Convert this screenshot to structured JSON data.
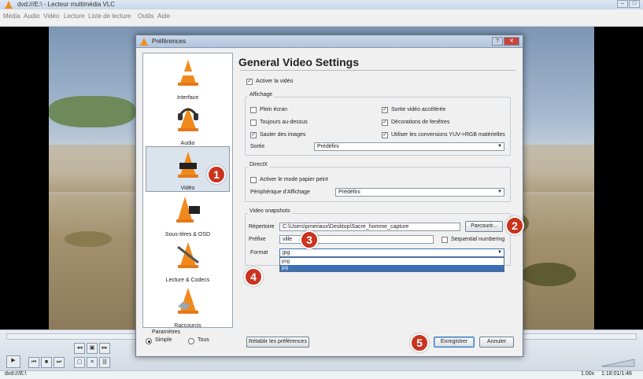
{
  "window": {
    "title": "dvd:///E:\\ - Lecteur multimédia VLC"
  },
  "menu": [
    "Média",
    "Audio",
    "Vidéo",
    "Lecture",
    "Liste de lecture",
    "Outils",
    "Aide"
  ],
  "status": {
    "path": "dvd:///E:\\",
    "speed": "1.00x",
    "time": "1:18:01/1:46"
  },
  "dialog": {
    "title": "Préférences",
    "panel_title": "General Video Settings",
    "categories": [
      {
        "label": "Interface",
        "icon": "interface-icon"
      },
      {
        "label": "Audio",
        "icon": "audio-icon"
      },
      {
        "label": "Vidéo",
        "icon": "video-icon"
      },
      {
        "label": "Sous-titres & OSD",
        "icon": "subtitles-icon"
      },
      {
        "label": "Lecture & Codecs",
        "icon": "codecs-icon"
      },
      {
        "label": "Raccourcis",
        "icon": "hotkeys-icon"
      }
    ],
    "params_label": "Paramètres",
    "mode_simple": "Simple",
    "mode_all": "Tous",
    "enable_video": "Activer la vidéo",
    "display_group": "Affichage",
    "fullscreen": "Plein écran",
    "always_on_top": "Toujours au-dessus",
    "skip_frames": "Sauter des images",
    "accel_output": "Sortie vidéo accélérée",
    "window_decorations": "Décorations de fenêtres",
    "yuv_rgb": "Utiliser les conversions YUV->RGB matérielles",
    "output_label": "Sortie",
    "output_value": "Prédéfini",
    "directx_group": "DirectX",
    "wallpaper_mode": "Activer le mode papier peint",
    "display_device_label": "Périphérique d'Affichage",
    "display_device_value": "Prédéfini",
    "snapshots_group": "Video snapshots",
    "directory_label": "Répertoire",
    "directory_value": "C:\\Users\\pmeriaux\\Desktop\\Sacre_homme_capture",
    "browse_button": "Parcourir...",
    "prefix_label": "Préfixe",
    "prefix_value": "ville",
    "sequential_numbering": "Sequential numbering",
    "format_label": "Format",
    "format_value": "jpg",
    "format_options": [
      "png",
      "jpg"
    ],
    "reset_button": "Rétablir les préférences",
    "save_button": "Enregistrer",
    "cancel_button": "Annuler"
  },
  "callouts": [
    "1",
    "2",
    "3",
    "4",
    "5"
  ],
  "checkbox_states": {
    "enable_video": true,
    "fullscreen": false,
    "always_on_top": false,
    "skip_frames": true,
    "accel_output": true,
    "window_decorations": true,
    "yuv_rgb": true,
    "wallpaper_mode": false,
    "sequential_numbering": false
  },
  "colors": {
    "callout": "#c9341f",
    "selection": "#3b6fb6",
    "vlc_orange": "#f18a1c"
  }
}
